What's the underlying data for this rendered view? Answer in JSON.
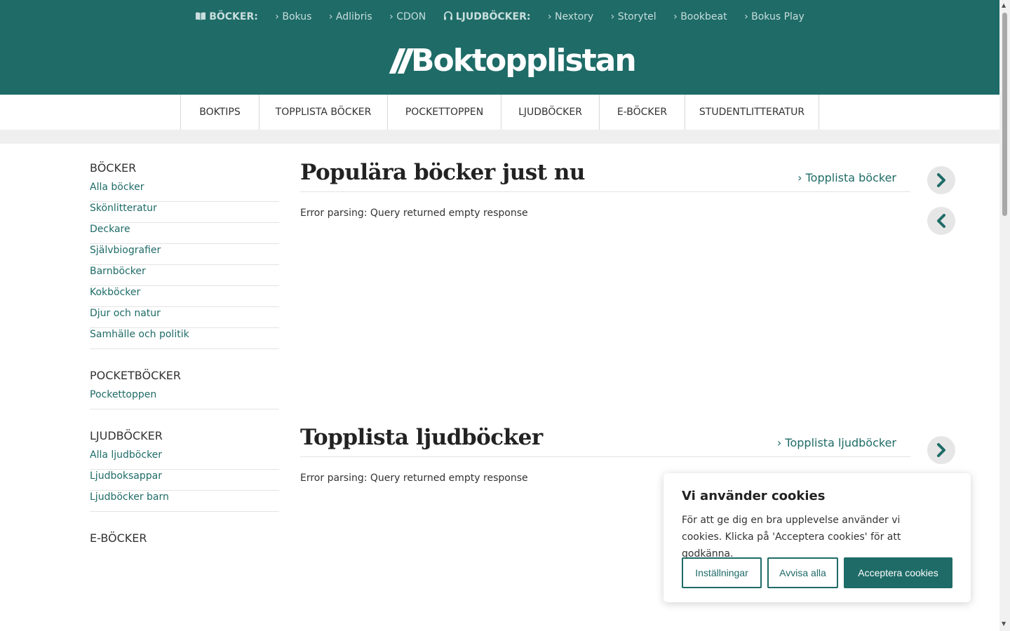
{
  "header": {
    "books_group": "BÖCKER:",
    "books_links": [
      "› Bokus",
      "› Adlibris",
      "› CDON"
    ],
    "audio_group": "LJUDBÖCKER:",
    "audio_links": [
      "› Nextory",
      "› Storytel",
      "› Bookbeat",
      "› Bokus Play"
    ],
    "logo_text": "Boktopplistan",
    "brand_color": "#1e6b67"
  },
  "nav": {
    "items": [
      "BOKTIPS",
      "TOPPLISTA BÖCKER",
      "POCKETTOPPEN",
      "LJUDBÖCKER",
      "E-BÖCKER",
      "STUDENTLITTERATUR"
    ]
  },
  "sidebar": {
    "groups": [
      {
        "heading": "BÖCKER",
        "items": [
          "Alla böcker",
          "Skönlitteratur",
          "Deckare",
          "Självbiografier",
          "Barnböcker",
          "Kokböcker",
          "Djur och natur",
          "Samhälle och politik"
        ]
      },
      {
        "heading": "POCKETBÖCKER",
        "items": [
          "Pockettoppen"
        ]
      },
      {
        "heading": "LJUDBÖCKER",
        "items": [
          "Alla ljudböcker",
          "Ljudboksappar",
          "Ljudböcker barn"
        ]
      },
      {
        "heading": "E-BÖCKER",
        "items": []
      }
    ]
  },
  "main": {
    "sections": [
      {
        "title": "Populära böcker just nu",
        "link": "› Topplista böcker",
        "error": "Error parsing: Query returned empty response"
      },
      {
        "title": "Topplista ljudböcker",
        "link": "› Topplista ljudböcker",
        "error": "Error parsing: Query returned empty response"
      }
    ]
  },
  "cookie": {
    "title": "Vi använder cookies",
    "text": "För att ge dig en bra upplevelse använder vi cookies. Klicka på 'Acceptera cookies' för att godkänna.",
    "settings_label": "Inställningar",
    "reject_label": "Avvisa alla",
    "accept_label": "Acceptera cookies"
  },
  "icons": {
    "next": "chevron-right-icon",
    "prev": "chevron-left-icon",
    "book": "open-book-icon",
    "headphones": "headphones-icon"
  }
}
